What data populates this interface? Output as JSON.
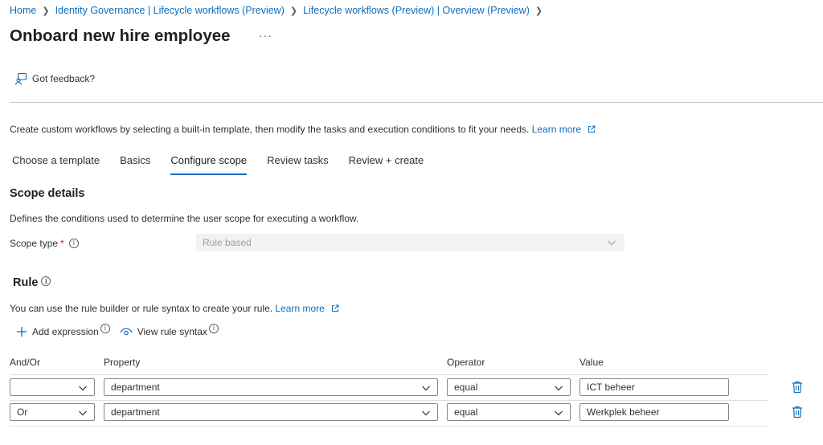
{
  "breadcrumb": [
    "Home",
    "Identity Governance | Lifecycle workflows (Preview)",
    "Lifecycle workflows (Preview) | Overview (Preview)"
  ],
  "page": {
    "title": "Onboard new hire employee",
    "more": "···"
  },
  "feedback": {
    "label": "Got feedback?"
  },
  "intro": {
    "text": "Create custom workflows by selecting a built-in template, then modify the tasks and execution conditions to fit your needs.",
    "link": "Learn more"
  },
  "tabs": [
    "Choose a template",
    "Basics",
    "Configure scope",
    "Review tasks",
    "Review + create"
  ],
  "active_tab": "Configure scope",
  "scope": {
    "title": "Scope details",
    "desc": "Defines the conditions used to determine the user scope for executing a workflow.",
    "type_label": "Scope type",
    "required_mark": "*",
    "type_value": "Rule based"
  },
  "rule": {
    "title": "Rule",
    "desc": "You can use the rule builder or rule syntax to create your rule.",
    "link": "Learn more",
    "add_expression": "Add expression",
    "view_syntax": "View rule syntax"
  },
  "table": {
    "headers": {
      "andor": "And/Or",
      "property": "Property",
      "operator": "Operator",
      "value": "Value"
    },
    "rows": [
      {
        "andor": "",
        "property": "department",
        "operator": "equal",
        "value": "ICT beheer"
      },
      {
        "andor": "Or",
        "property": "department",
        "operator": "equal",
        "value": "Werkplek beheer"
      }
    ]
  },
  "colors": {
    "accent": "#0f6cbd",
    "text": "#323130",
    "required": "#a4262c",
    "disabled_bg": "#f3f2f1"
  },
  "icons": {
    "feedback": "feedback-person-icon",
    "external": "external-link-icon",
    "add": "plus-icon",
    "view": "eye-icon",
    "delete": "trash-icon",
    "dropdown": "chevron-down-icon",
    "info": "info-icon"
  }
}
